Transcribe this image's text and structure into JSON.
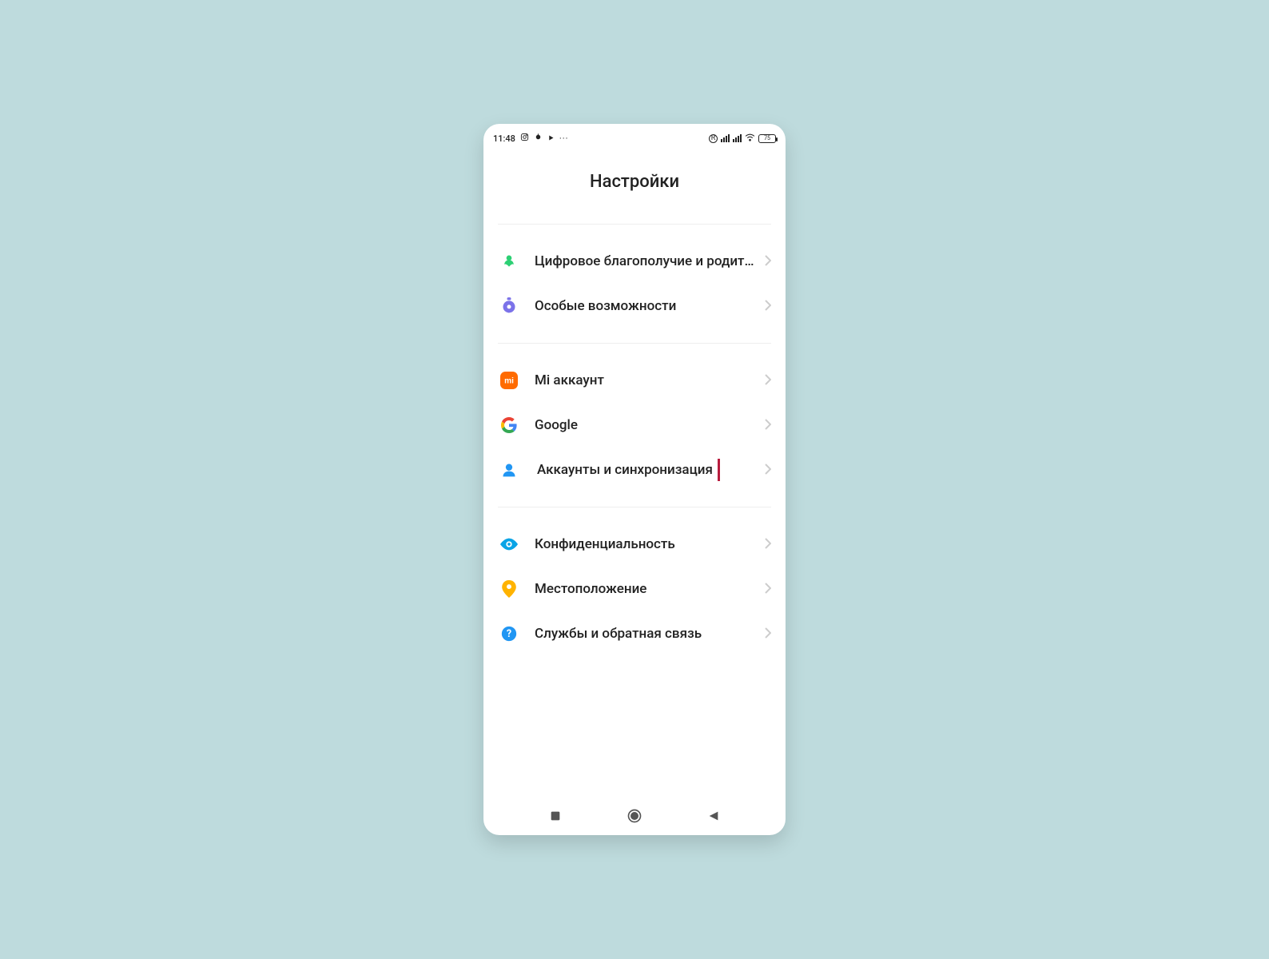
{
  "status": {
    "time": "11:48",
    "battery": "75"
  },
  "title": "Настройки",
  "groups": [
    {
      "items": [
        {
          "label": "Цифровое благополучие и родит…"
        },
        {
          "label": "Особые возможности"
        }
      ]
    },
    {
      "items": [
        {
          "label": "Mi аккаунт"
        },
        {
          "label": "Google"
        },
        {
          "label": "Аккаунты и синхронизация"
        }
      ]
    },
    {
      "items": [
        {
          "label": "Конфиденциальность"
        },
        {
          "label": "Местоположение"
        },
        {
          "label": "Службы и обратная связь"
        }
      ]
    }
  ]
}
